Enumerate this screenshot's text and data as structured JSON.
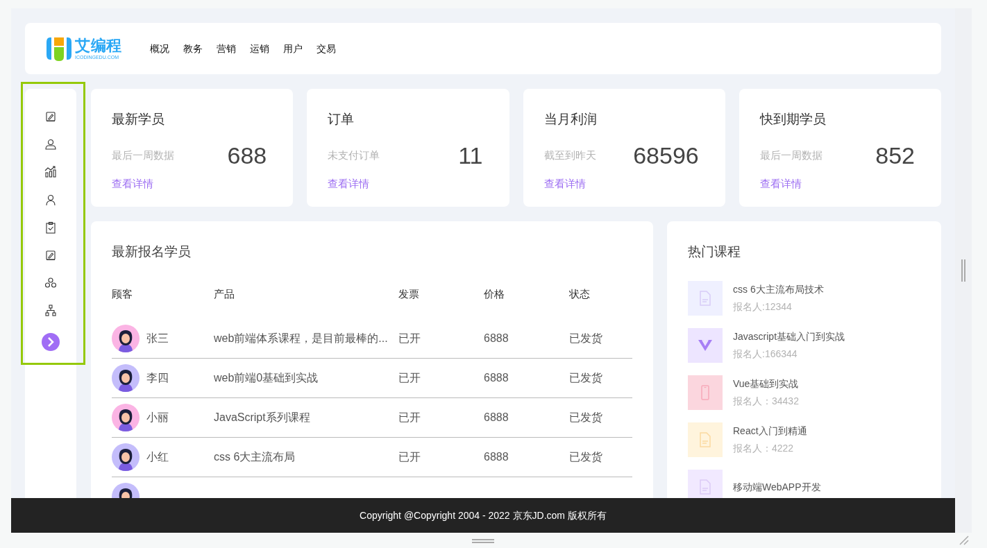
{
  "logo": {
    "name": "艾编程",
    "domain": "ICODINGEDU.COM"
  },
  "nav": [
    {
      "label": "概况"
    },
    {
      "label": "教务"
    },
    {
      "label": "营销"
    },
    {
      "label": "运销"
    },
    {
      "label": "用户"
    },
    {
      "label": "交易"
    }
  ],
  "stats": [
    {
      "title": "最新学员",
      "subtitle": "最后一周数据",
      "value": "688",
      "link": "查看详情"
    },
    {
      "title": "订单",
      "subtitle": "未支付订单",
      "value": "11",
      "link": "查看详情"
    },
    {
      "title": "当月利润",
      "subtitle": "截至到昨天",
      "value": "68596",
      "link": "查看详情"
    },
    {
      "title": "快到期学员",
      "subtitle": "最后一周数据",
      "value": "852",
      "link": "查看详情"
    }
  ],
  "table": {
    "title": "最新报名学员",
    "columns": [
      "顾客",
      "产品",
      "发票",
      "价格",
      "状态"
    ],
    "rows": [
      {
        "customer": "张三",
        "color": "#fbb4e4",
        "product": "web前端体系课程，是目前最棒的...",
        "invoice": "已开",
        "price": "6888",
        "status": "已发货"
      },
      {
        "customer": "李四",
        "color": "#c4bdfb",
        "product": "web前端0基础到实战",
        "invoice": "已开",
        "price": "6888",
        "status": "已发货"
      },
      {
        "customer": "小丽",
        "color": "#fbb4e4",
        "product": "JavaScript系列课程",
        "invoice": "已开",
        "price": "6888",
        "status": "已发货"
      },
      {
        "customer": "小红",
        "color": "#c4bdfb",
        "product": "css 6大主流布局",
        "invoice": "已开",
        "price": "6888",
        "status": "已发货"
      },
      {
        "color": "#c4bdfb"
      }
    ]
  },
  "courses": {
    "title": "热门课程",
    "items": [
      {
        "kind": "css",
        "name": "css 6大主流布局技术",
        "signups": "报名人:12344"
      },
      {
        "kind": "vue",
        "name": "Javascript基础入门到实战",
        "signups": "报名人:166344"
      },
      {
        "kind": "phone",
        "name": "Vue基础到实战",
        "signups": "报名人：34432"
      },
      {
        "kind": "js",
        "name": "React入门到精通",
        "signups": "报名人：4222"
      },
      {
        "kind": "jsfile",
        "name": "移动端WebAPP开发"
      }
    ]
  },
  "footer": "Copyright @Copyright 2004 - 2022 京东JD.com 版权所有"
}
